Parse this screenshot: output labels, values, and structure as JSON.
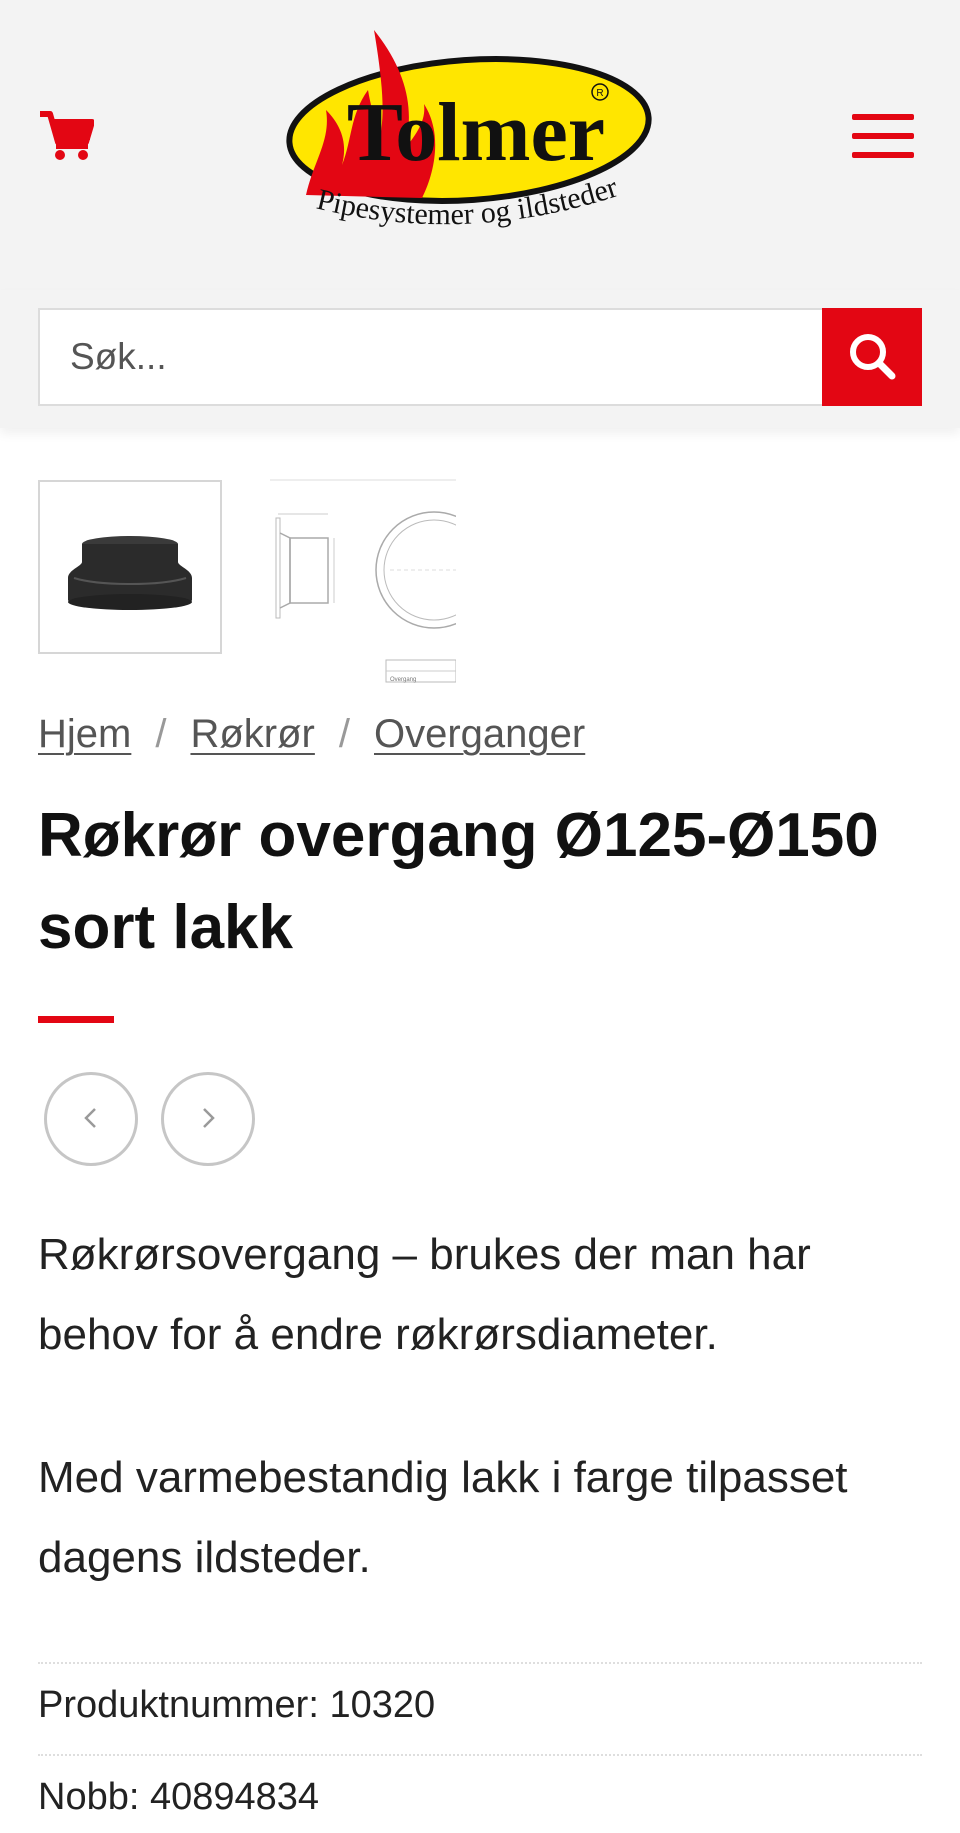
{
  "header": {
    "logo": {
      "brand": "Tolmer",
      "registered_mark": "R",
      "tagline": "Pipesystemer og ildsteder"
    },
    "cart_icon": "shopping-cart-icon",
    "menu_icon": "hamburger-menu-icon"
  },
  "search": {
    "placeholder": "Søk...",
    "button_icon": "search-icon"
  },
  "colors": {
    "accent": "#e30613",
    "logo_yellow": "#ffe600",
    "header_bg": "#f3f3f3"
  },
  "gallery": {
    "thumbnails": [
      {
        "name": "product-photo-thumbnail",
        "selected": true
      },
      {
        "name": "technical-drawing-thumbnail",
        "selected": false,
        "caption": "Overgang"
      }
    ]
  },
  "breadcrumb": {
    "items": [
      "Hjem",
      "Røkrør",
      "Overganger"
    ],
    "separator": "/"
  },
  "product": {
    "title": "Røkrør overgang Ø125-Ø150 sort lakk",
    "description": [
      "Røkrørsovergang – brukes der man har behov for å endre røkrørsdiameter.",
      "Med varmebestandig lakk i farge tilpasset dagens ildsteder."
    ],
    "meta": [
      {
        "label": "Produktnummer:",
        "value": "10320"
      },
      {
        "label": "Nobb:",
        "value": "40894834"
      }
    ]
  },
  "product_nav": {
    "prev_icon": "chevron-left-icon",
    "next_icon": "chevron-right-icon"
  }
}
